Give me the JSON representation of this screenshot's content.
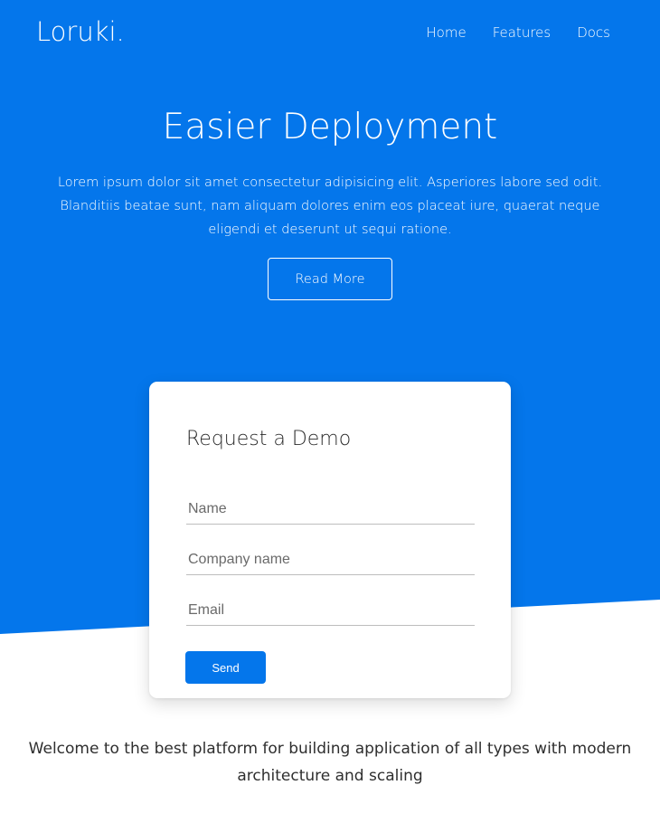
{
  "colors": {
    "brand_blue": "#0476eb",
    "white": "#ffffff",
    "text_dark": "#2e2e2e"
  },
  "header": {
    "logo": "Loruki.",
    "nav": [
      {
        "label": "Home"
      },
      {
        "label": "Features"
      },
      {
        "label": "Docs"
      }
    ]
  },
  "hero": {
    "title": "Easier Deployment",
    "description": "Lorem ipsum dolor sit amet consectetur adipisicing elit. Asperiores labore sed odit. Blanditiis beatae sunt, nam aliquam dolores enim eos placeat iure, quaerat neque eligendi et deserunt ut sequi ratione.",
    "cta_label": "Read More"
  },
  "demo_form": {
    "title": "Request a Demo",
    "fields": [
      {
        "placeholder": "Name",
        "value": ""
      },
      {
        "placeholder": "Company name",
        "value": ""
      },
      {
        "placeholder": "Email",
        "value": ""
      }
    ],
    "submit_label": "Send"
  },
  "welcome": {
    "text": "Welcome to the best platform for building application of all types with modern architecture and scaling"
  }
}
